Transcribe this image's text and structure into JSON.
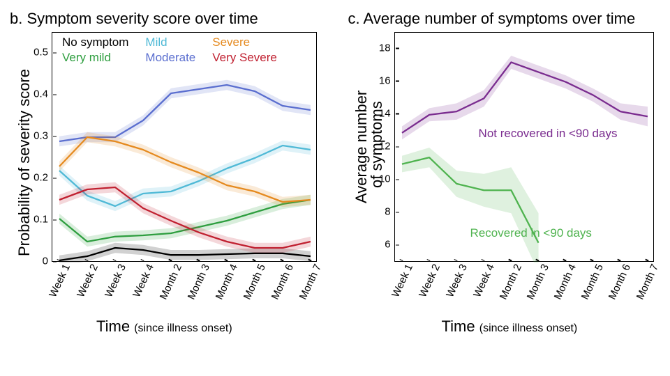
{
  "panel_b": {
    "title": "b. Symptom severity score over time",
    "ylabel": "Probability of severity score",
    "xlabel_main": "Time ",
    "xlabel_sub": "(since illness onset)",
    "legend": {
      "no_symptom": "No symptom",
      "very_mild": "Very mild",
      "mild": "Mild",
      "moderate": "Moderate",
      "severe": "Severe",
      "very_severe": "Very Severe"
    }
  },
  "panel_c": {
    "title": "c. Average number of symptoms over time",
    "ylabel_l1": "Average number",
    "ylabel_l2": "of symptoms",
    "xlabel_main": "Time ",
    "xlabel_sub": "(since illness onset)",
    "annot_not_recovered": "Not recovered in <90 days",
    "annot_recovered": "Recovered in <90 days"
  },
  "chart_data": [
    {
      "id": "panel_b",
      "type": "line",
      "title": "Symptom severity score over time",
      "xlabel": "Time (since illness onset)",
      "ylabel": "Probability of severity score",
      "ylim": [
        0,
        0.55
      ],
      "x_categories": [
        "Week 1",
        "Week 2",
        "Week 3",
        "Week 4",
        "Month 2",
        "Month 3",
        "Month 4",
        "Month 5",
        "Month 6",
        "Month 7"
      ],
      "series": [
        {
          "name": "No symptom",
          "color": "#000000",
          "values": [
            0.005,
            0.015,
            0.035,
            0.03,
            0.018,
            0.018,
            0.02,
            0.022,
            0.022,
            0.015
          ]
        },
        {
          "name": "Very mild",
          "color": "#2e9e3f",
          "values": [
            0.105,
            0.05,
            0.062,
            0.065,
            0.07,
            0.085,
            0.1,
            0.12,
            0.14,
            0.15
          ]
        },
        {
          "name": "Mild",
          "color": "#4fb9d6",
          "values": [
            0.22,
            0.16,
            0.135,
            0.165,
            0.17,
            0.195,
            0.225,
            0.25,
            0.28,
            0.27
          ]
        },
        {
          "name": "Moderate",
          "color": "#5a6ecf",
          "values": [
            0.29,
            0.3,
            0.3,
            0.34,
            0.405,
            0.415,
            0.425,
            0.41,
            0.375,
            0.365
          ]
        },
        {
          "name": "Severe",
          "color": "#e58a1f",
          "values": [
            0.23,
            0.3,
            0.29,
            0.27,
            0.24,
            0.215,
            0.185,
            0.17,
            0.145,
            0.15
          ]
        },
        {
          "name": "Very Severe",
          "color": "#c02030",
          "values": [
            0.15,
            0.175,
            0.18,
            0.13,
            0.1,
            0.072,
            0.05,
            0.035,
            0.035,
            0.05
          ]
        }
      ],
      "band_halfwidth": 0.012
    },
    {
      "id": "panel_c",
      "type": "line",
      "title": "Average number of symptoms over time",
      "xlabel": "Time (since illness onset)",
      "ylabel": "Average number of symptoms",
      "ylim": [
        5,
        19
      ],
      "x_categories": [
        "Week 1",
        "Week 2",
        "Week 3",
        "Week 4",
        "Month 2",
        "Month 3",
        "Month 4",
        "Month 5",
        "Month 6",
        "Month 7"
      ],
      "series": [
        {
          "name": "Not recovered in <90 days",
          "color": "#7a2c8f",
          "values": [
            12.9,
            14.0,
            14.2,
            15.0,
            17.2,
            16.6,
            16.0,
            15.2,
            14.2,
            13.9
          ],
          "band": [
            0.4,
            0.4,
            0.5,
            0.5,
            0.4,
            0.4,
            0.4,
            0.4,
            0.5,
            0.6
          ]
        },
        {
          "name": "Recovered in <90 days",
          "color": "#4fb34f",
          "values": [
            11.0,
            11.4,
            9.8,
            9.4,
            9.4,
            6.2,
            null,
            null,
            null,
            null
          ],
          "band": [
            0.5,
            0.6,
            0.8,
            1.0,
            1.4,
            1.8,
            null,
            null,
            null,
            null
          ]
        }
      ]
    }
  ]
}
